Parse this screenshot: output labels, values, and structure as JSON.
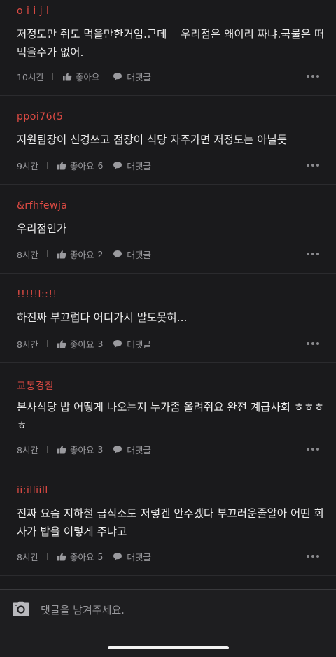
{
  "comments": [
    {
      "author": "o i i j l",
      "text": "저정도만 줘도 먹을만한거임.근데    우리점은 왜이리 짜냐.국물은 떠먹을수가 없어.",
      "time": "10시간",
      "like_label": "좋아요",
      "like_count": "",
      "reply_label": "대댓글"
    },
    {
      "author": "ppoi76(5",
      "text": "지원팀장이 신경쓰고 점장이 식당 자주가면 저정도는 아닐듯",
      "time": "9시간",
      "like_label": "좋아요",
      "like_count": "6",
      "reply_label": "대댓글"
    },
    {
      "author": "&rfhfewja",
      "text": "우리점인가",
      "time": "8시간",
      "like_label": "좋아요",
      "like_count": "2",
      "reply_label": "대댓글"
    },
    {
      "author": "!!!!!l::!!",
      "text": "하진짜 부끄럽다 어디가서 말도못혀...",
      "time": "8시간",
      "like_label": "좋아요",
      "like_count": "3",
      "reply_label": "대댓글"
    },
    {
      "author": "교통경찰",
      "text": "본사식당 밥 어떻게 나오는지 누가좀 올려줘요 완전 계급사회 ㅎㅎㅎㅎ",
      "time": "8시간",
      "like_label": "좋아요",
      "like_count": "3",
      "reply_label": "대댓글"
    },
    {
      "author": "ii;illiill",
      "text": "진짜 요즘 지하철 급식소도 저렇겐 안주겠다 부끄러운줄알아 어떤 회사가 밥을 이렇게 주냐고",
      "time": "8시간",
      "like_label": "좋아요",
      "like_count": "5",
      "reply_label": "대댓글"
    }
  ],
  "reply_input": {
    "placeholder": "댓글을 남겨주세요."
  },
  "icons": {
    "like": "thumbs-up-icon",
    "reply": "speech-bubble-icon",
    "more": "more-dots-icon",
    "camera": "camera-icon"
  },
  "colors": {
    "background": "#1a1a1c",
    "author": "#e04b44",
    "meta": "#9a9a9e"
  }
}
